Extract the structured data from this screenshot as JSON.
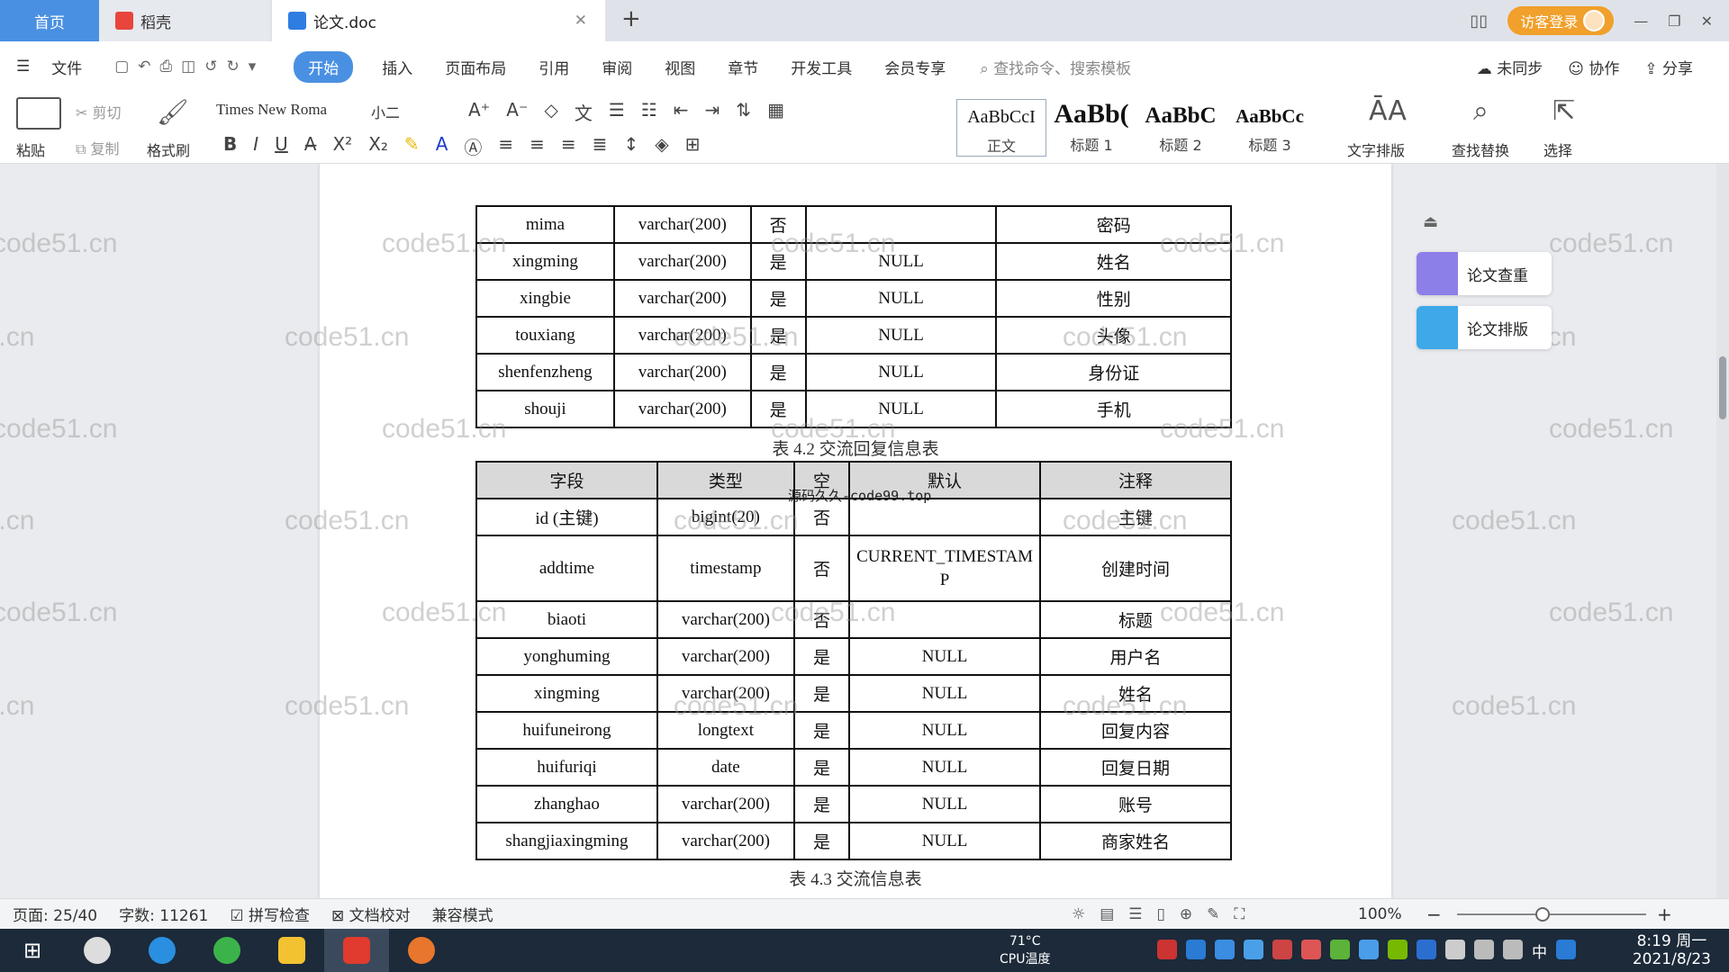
{
  "titlebar": {
    "tabs": [
      {
        "label": "首页"
      },
      {
        "label": "稻壳"
      },
      {
        "label": "论文.doc"
      }
    ],
    "new_tab": "+",
    "login": "访客登录"
  },
  "menu": {
    "items": [
      "文件",
      "开始",
      "插入",
      "页面布局",
      "引用",
      "审阅",
      "视图",
      "章节",
      "开发工具",
      "会员专享"
    ],
    "search": "查找命令、搜索模板",
    "right": [
      "未同步",
      "协作",
      "分享"
    ]
  },
  "ribbon": {
    "paste": "粘贴",
    "cut": "剪切",
    "copy": "复制",
    "format_painter": "格式刷",
    "font": "Times New Roma",
    "size": "小二",
    "styles": [
      {
        "preview": "AaBbCcI",
        "label": "正文"
      },
      {
        "preview": "AaBb(",
        "label": "标题 1"
      },
      {
        "preview": "AaBbC",
        "label": "标题 2"
      },
      {
        "preview": "AaBbCc",
        "label": "标题 3"
      }
    ],
    "layout": "文字排版",
    "find_replace": "查找替换",
    "select": "选择"
  },
  "table1": {
    "rows": [
      [
        "mima",
        "varchar(200)",
        "否",
        "",
        "密码"
      ],
      [
        "xingming",
        "varchar(200)",
        "是",
        "NULL",
        "姓名"
      ],
      [
        "xingbie",
        "varchar(200)",
        "是",
        "NULL",
        "性别"
      ],
      [
        "touxiang",
        "varchar(200)",
        "是",
        "NULL",
        "头像"
      ],
      [
        "shenfenzheng",
        "varchar(200)",
        "是",
        "NULL",
        "身份证"
      ],
      [
        "shouji",
        "varchar(200)",
        "是",
        "NULL",
        "手机"
      ]
    ]
  },
  "caption1": "表 4.2  交流回复信息表",
  "table2": {
    "header": [
      "字段",
      "类型",
      "空",
      "默认",
      "注释"
    ],
    "rows": [
      [
        "id (主键)",
        "bigint(20)",
        "否",
        "",
        "主键"
      ],
      [
        "addtime",
        "timestamp",
        "否",
        "CURRENT_TIMESTAMP",
        "创建时间"
      ],
      [
        "biaoti",
        "varchar(200)",
        "否",
        "",
        "标题"
      ],
      [
        "yonghuming",
        "varchar(200)",
        "是",
        "NULL",
        "用户名"
      ],
      [
        "xingming",
        "varchar(200)",
        "是",
        "NULL",
        "姓名"
      ],
      [
        "huifuneirong",
        "longtext",
        "是",
        "NULL",
        "回复内容"
      ],
      [
        "huifuriqi",
        "date",
        "是",
        "NULL",
        "回复日期"
      ],
      [
        "zhanghao",
        "varchar(200)",
        "是",
        "NULL",
        "账号"
      ],
      [
        "shangjiaxingming",
        "varchar(200)",
        "是",
        "NULL",
        "商家姓名"
      ]
    ]
  },
  "caption2": "表 4.3  交流信息表",
  "source_note": "源码久久-code99.top",
  "watermark": "code51.cn",
  "side": {
    "check": "论文查重",
    "format": "论文排版"
  },
  "status": {
    "page": "页面: 25/40",
    "words": "字数: 11261",
    "spell": "拼写检查",
    "proof": "文档校对",
    "compat": "兼容模式",
    "zoom": "100%"
  },
  "taskbar": {
    "temp": "71°C",
    "cpu": "CPU温度",
    "ime": "中",
    "time": "8:19 周一",
    "date": "2021/8/23"
  }
}
